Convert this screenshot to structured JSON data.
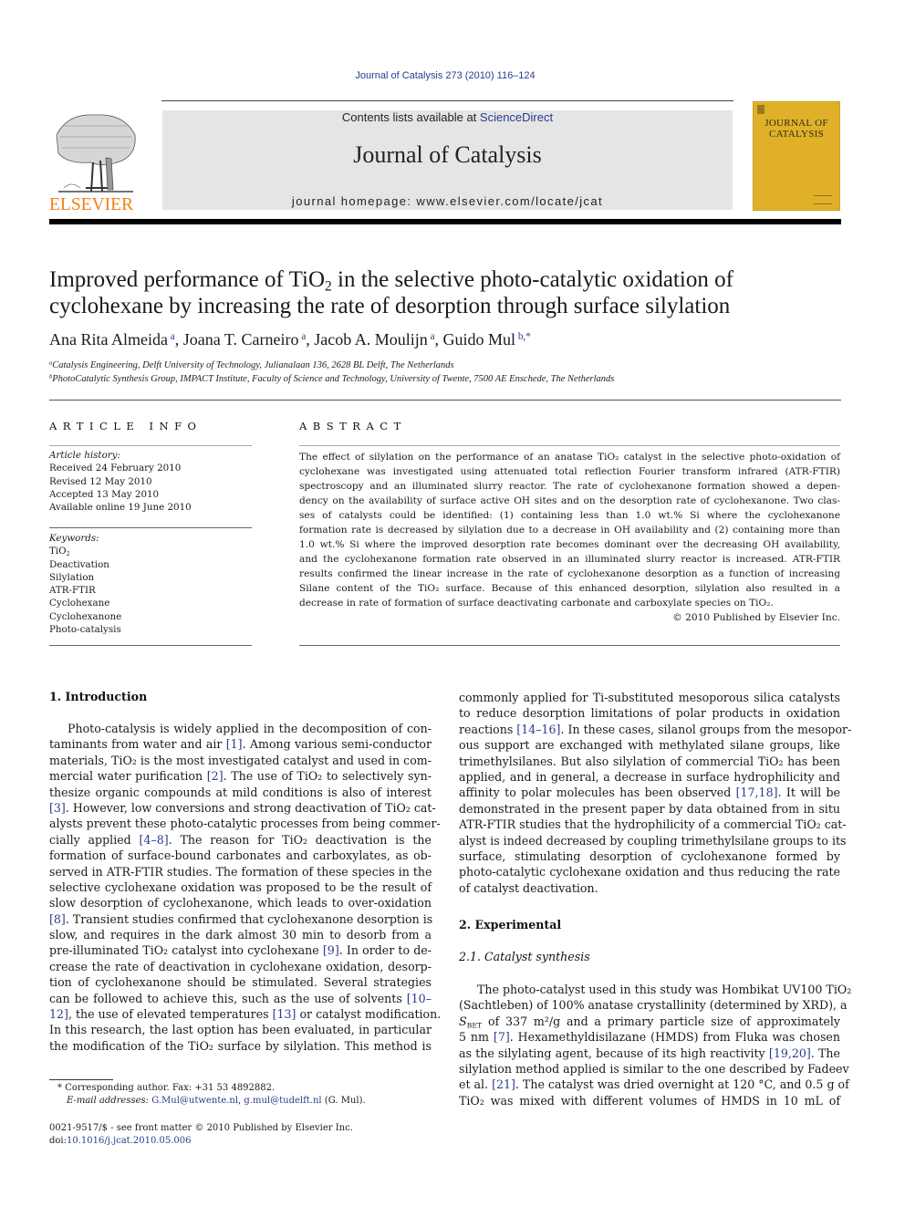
{
  "running_head": "Journal of Catalysis 273 (2010) 116–124",
  "masthead": {
    "publisher_logo_text": "ELSEVIER",
    "contents_prefix": "Contents lists available at ",
    "contents_link": "ScienceDirect",
    "journal_title": "Journal of Catalysis",
    "homepage": "journal homepage: www.elsevier.com/locate/jcat",
    "cover_title_line1": "JOURNAL OF",
    "cover_title_line2": "CATALYSIS"
  },
  "colors": {
    "link": "#2b3a8f",
    "elsevier_orange": "#f07f1a",
    "masthead_gray": "#e5e5e5",
    "cover_yellow": "#e0b128"
  },
  "article": {
    "title_part1": "Improved performance of TiO",
    "title_sub": "2",
    "title_part2": " in the selective photo-catalytic oxidation of",
    "title_line2": "cyclohexane by increasing the rate of desorption through surface silylation",
    "authors": [
      {
        "name": "Ana Rita Almeida",
        "sup": "a"
      },
      {
        "name": "Joana T. Carneiro",
        "sup": "a"
      },
      {
        "name": "Jacob A. Moulijn",
        "sup": "a"
      },
      {
        "name": "Guido Mul",
        "sup": "b,*"
      }
    ],
    "affiliations": [
      {
        "mark": "a",
        "text": "Catalysis Engineering, Delft University of Technology, Julianalaan 136, 2628 BL Delft, The Netherlands"
      },
      {
        "mark": "b",
        "text": "PhotoCatalytic Synthesis Group, IMPACT Institute, Faculty of Science and Technology, University of Twente, 7500 AE Enschede, The Netherlands"
      }
    ]
  },
  "article_info": {
    "heading": "ARTICLE INFO",
    "history_label": "Article history:",
    "history": [
      "Received 24 February 2010",
      "Revised 12 May 2010",
      "Accepted 13 May 2010",
      "Available online 19 June 2010"
    ],
    "keywords_label": "Keywords:",
    "keywords": [
      "TiO2",
      "Deactivation",
      "Silylation",
      "ATR-FTIR",
      "Cyclohexane",
      "Cyclohexanone",
      "Photo-catalysis"
    ]
  },
  "abstract": {
    "heading": "ABSTRACT",
    "lines": [
      "The effect of silylation on the performance of an anatase TiO₂ catalyst in the selective photo-oxidation of",
      "cyclohexane was investigated using attenuated total reflection Fourier transform infrared (ATR-FTIR)",
      "spectroscopy and an illuminated slurry reactor. The rate of cyclohexanone formation showed a depen-",
      "dency on the availability of surface active OH sites and on the desorption rate of cyclohexanone. Two clas-",
      "ses of catalysts could be identified: (1) containing less than 1.0 wt.% Si where the cyclohexanone",
      "formation rate is decreased by silylation due to a decrease in OH availability and (2) containing more than",
      "1.0 wt.% Si where the improved desorption rate becomes dominant over the decreasing OH availability,",
      "and the cyclohexanone formation rate observed in an illuminated slurry reactor is increased. ATR-FTIR",
      "results confirmed the linear increase in the rate of cyclohexanone desorption as a function of increasing",
      "Silane content of the TiO₂ surface. Because of this enhanced desorption, silylation also resulted in a",
      "decrease in rate of formation of surface deactivating carbonate and carboxylate species on TiO₂."
    ],
    "copyright": "© 2010 Published by Elsevier Inc."
  },
  "sections": {
    "intro_heading": "1. Introduction",
    "intro_lines": [
      "Photo-catalysis is widely applied in the decomposition of con-",
      "taminants from water and air [1]. Among various semi-conductor",
      "materials, TiO₂ is the most investigated catalyst and used in com-",
      "mercial water purification [2]. The use of TiO₂ to selectively syn-",
      "thesize organic compounds at mild conditions is also of interest",
      "[3]. However, low conversions and strong deactivation of TiO₂ cat-",
      "alysts prevent these photo-catalytic processes from being commer-",
      "cially applied [4–8]. The reason for TiO₂ deactivation is the",
      "formation of surface-bound carbonates and carboxylates, as ob-",
      "served in ATR-FTIR studies. The formation of these species in the",
      "selective cyclohexane oxidation was proposed to be the result of",
      "slow desorption of cyclohexanone, which leads to over-oxidation",
      "[8]. Transient studies confirmed that cyclohexanone desorption is",
      "slow, and requires in the dark almost 30 min to desorb from a",
      "pre-illuminated TiO₂ catalyst into cyclohexane [9]. In order to de-",
      "crease the rate of deactivation in cyclohexane oxidation, desorp-",
      "tion of cyclohexanone should be stimulated. Several strategies",
      "can be followed to achieve this, such as the use of solvents [10–",
      "12], the use of elevated temperatures [13] or catalyst modification.",
      "In this research, the last option has been evaluated, in particular",
      "the modification of the TiO₂ surface by silylation. This method is"
    ],
    "intro_cont_lines": [
      "commonly applied for Ti-substituted mesoporous silica catalysts",
      "to reduce desorption limitations of polar products in oxidation",
      "reactions [14–16]. In these cases, silanol groups from the mesopor-",
      "ous support are exchanged with methylated silane groups, like",
      "trimethylsilanes. But also silylation of commercial TiO₂ has been",
      "applied, and in general, a decrease in surface hydrophilicity and",
      "affinity to polar molecules has been observed [17,18]. It will be",
      "demonstrated in the present paper by data obtained from in situ",
      "ATR-FTIR studies that the hydrophilicity of a commercial TiO₂ cat-",
      "alyst is indeed decreased by coupling trimethylsilane groups to its",
      "surface, stimulating desorption of cyclohexanone formed by",
      "photo-catalytic cyclohexane oxidation and thus reducing the rate",
      "of catalyst deactivation."
    ],
    "exp_heading": "2. Experimental",
    "subsec_heading": "2.1. Catalyst synthesis",
    "exp_lines": [
      "The photo-catalyst used in this study was Hombikat UV100 TiO₂",
      "(Sachtleben) of 100% anatase crystallinity (determined by XRD), a",
      "S_BET of 337 m²/g and a primary particle size of approximately",
      "5 nm [7]. Hexamethyldisilazane (HMDS) from Fluka was chosen",
      "as the silylating agent, because of its high reactivity [19,20]. The",
      "silylation method applied is similar to the one described by Fadeev",
      "et al. [21]. The catalyst was dried overnight at 120 °C, and 0.5 g of",
      "TiO₂ was mixed with different volumes of HMDS in 10 mL of"
    ]
  },
  "footnotes": {
    "corresponding": "* Corresponding author. Fax: +31 53 4892882.",
    "email_label": "E-mail addresses:",
    "email1": "G.Mul@utwente.nl",
    "email2": "g.mul@tudelft.nl",
    "email_suffix": " (G. Mul).",
    "issn": "0021-9517/$ - see front matter © 2010 Published by Elsevier Inc.",
    "doi_prefix": "doi:",
    "doi": "10.1016/j.jcat.2010.05.006"
  }
}
